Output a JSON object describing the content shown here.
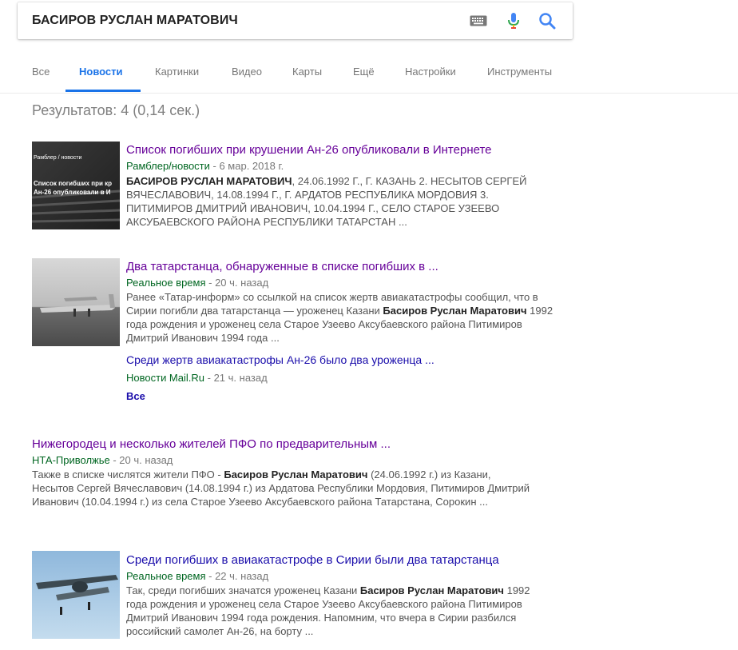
{
  "search": {
    "query": "БАСИРОВ РУСЛАН МАРАТОВИЧ",
    "icons": [
      "keyboard-icon",
      "microphone-icon",
      "search-icon"
    ]
  },
  "tabs": [
    {
      "label": "Все"
    },
    {
      "label": "Новости"
    },
    {
      "label": "Картинки"
    },
    {
      "label": "Видео"
    },
    {
      "label": "Карты"
    },
    {
      "label": "Ещё"
    },
    {
      "label": "Настройки"
    },
    {
      "label": "Инструменты"
    }
  ],
  "active_tab": "Новости",
  "stats": "Результатов: 4 (0,14 сек.)",
  "results": [
    {
      "title": "Список погибших при крушении Ан-26 опубликовали в Интернете",
      "source": "Рамблер/новости",
      "time": " - 6 мар. 2018 г.",
      "thumb_text": "Рамблер / новости\nСписок погибших при кр\nАн-26 опубликовали в И",
      "snippet_bold": "БАСИРОВ РУСЛАН МАРАТОВИЧ",
      "snippet_rest": ", 24.06.1992 Г., Г. КАЗАНЬ 2. НЕСЫТОВ СЕРГЕЙ ВЯЧЕСЛАВОВИЧ, 14.08.1994 Г., Г. АРДАТОВ РЕСПУБЛИКА МОРДОВИЯ 3. ПИТИМИРОВ ДМИТРИЙ ИВАНОВИЧ, 10.04.1994 Г., СЕЛО СТАРОЕ УЗЕЕВО АКСУБАЕВСКОГО РАЙОНА РЕСПУБЛИКИ ТАТАРСТАН ..."
    },
    {
      "title": "Два татарстанца, обнаруженные в списке погибших в ...",
      "source": "Реальное время",
      "time": " - 20 ч. назад",
      "snippet_pre": "Ранее «Татар-информ» со ссылкой на список жертв авиакатастрофы сообщил, что в Сирии погибли два татарстанца — уроженец Казани ",
      "snippet_bold": "Басиров Руслан Маратович",
      "snippet_rest": " 1992 года рождения и уроженец села Старое Узеево Аксубаевского района Питимиров Дмитрий Иванович 1994 года ...",
      "related_title": "Среди жертв авиакатастрофы Ан-26 было два уроженца ...",
      "related_source": "Новости Mail.Ru",
      "related_time": " - 21 ч. назад",
      "all_label": "Все"
    },
    {
      "title": "Нижегородец и несколько жителей ПФО по предварительным ...",
      "source": "НТА-Приволжье",
      "time": " - 20 ч. назад",
      "snippet_pre": "Также в списке числятся жители ПФО - ",
      "snippet_bold": "Басиров Руслан Маратович",
      "snippet_rest": " (24.06.1992 г.) из Казани, Несытов Сергей Вячеславович (14.08.1994 г.) из Ардатова Республики Мордовия, Питимиров Дмитрий Иванович (10.04.1994 г.) из села Старое Узеево Аксубаевского района Татарстана, Сорокин ..."
    },
    {
      "title": "Среди погибших в авиакатастрофе в Сирии были два татарстанца",
      "source": "Реальное время",
      "time": " - 22 ч. назад",
      "snippet_pre": "Так, среди погибших значатся уроженец Казани ",
      "snippet_bold": "Басиров Руслан Маратович",
      "snippet_rest": " 1992 года рождения и уроженец села Старое Узеево Аксубаевского района Питимиров Дмитрий Иванович 1994 года рождения. Напомним, что вчера в Сирии разбился российский самолет Ан-26, на борту ..."
    }
  ],
  "colors": {
    "link_visited": "#660099",
    "link": "#1a0dab",
    "source_green": "#006621",
    "accent_blue": "#1a73e8"
  }
}
